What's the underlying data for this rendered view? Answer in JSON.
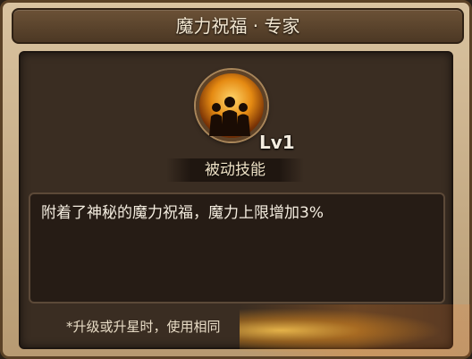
{
  "dialog": {
    "title": "魔力祝福 · 专家"
  },
  "skill": {
    "icon": "magic-blessing-icon",
    "level": "Lv1",
    "type": "被动技能",
    "description": "附着了神秘的魔力祝福，魔力上限增加3%"
  },
  "footer": {
    "note": "*升级或升星时，使用相同"
  },
  "colors": {
    "title_bar": "#4c3824",
    "panel_bg": "#3a2d22",
    "text": "#f4ede0",
    "icon_glow": "#e58a12"
  }
}
